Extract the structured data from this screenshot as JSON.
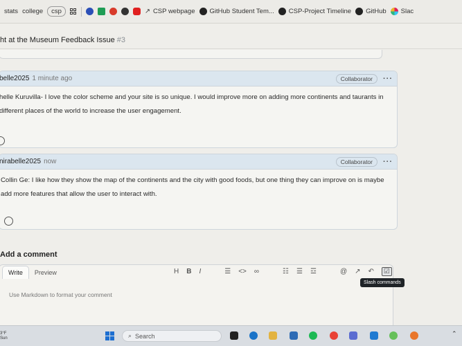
{
  "bookmarks": [
    {
      "label": "stats",
      "icon": "bookmark",
      "pill": false
    },
    {
      "label": "college",
      "icon": "bookmark",
      "pill": false
    },
    {
      "label": "csp",
      "icon": "bookmark",
      "pill": true
    },
    {
      "label": "",
      "icon": "apps-grid-icon"
    },
    {
      "label": "",
      "icon": "circle-blue-icon",
      "color": "#2b4fb7"
    },
    {
      "label": "",
      "icon": "drive-icon",
      "color": "#1f9d55"
    },
    {
      "label": "",
      "icon": "settings-red-icon",
      "color": "#d83b2b"
    },
    {
      "label": "",
      "icon": "chrome-dark-icon",
      "color": "#333333"
    },
    {
      "label": "",
      "icon": "youtube-icon",
      "color": "#e02020"
    },
    {
      "label": "CSP webpage",
      "icon": "arrow-icon"
    },
    {
      "label": "GitHub Student Tem...",
      "icon": "github-icon"
    },
    {
      "label": "CSP-Project Timeline",
      "icon": "github-icon"
    },
    {
      "label": "GitHub",
      "icon": "github-icon"
    },
    {
      "label": "Slac",
      "icon": "slack-icon"
    }
  ],
  "issue": {
    "title": "ht at the Museum Feedback Issue",
    "number": "#3"
  },
  "comments": [
    {
      "author": "belle2025",
      "time": "1 minute ago",
      "badge": "Collaborator",
      "menu": "···",
      "body": "helle Kuruvilla- I love the color scheme and your site is so unique. I would improve more on adding more continents and taurants in different places of the world to increase the user engagement."
    },
    {
      "author": "nirabelle2025",
      "time": "now",
      "badge": "Collaborator",
      "menu": "···",
      "body": "Collin Ge: I like how they show the map of the continents and the city with good foods, but one thing they can improve on is maybe add more features that allow the user to interact with."
    }
  ],
  "editor": {
    "heading": "Add a comment",
    "tabs": [
      "Write",
      "Preview"
    ],
    "toolbar": [
      "H",
      "B",
      "I"
    ],
    "placeholder": "Use Markdown to format your comment",
    "tooltip": "Slash commands"
  },
  "taskbar": {
    "search": "Search",
    "left_text": "3°F\nSun"
  },
  "colors": {
    "accent": "#dbe6ef",
    "taskbar": "#d9dde2"
  }
}
